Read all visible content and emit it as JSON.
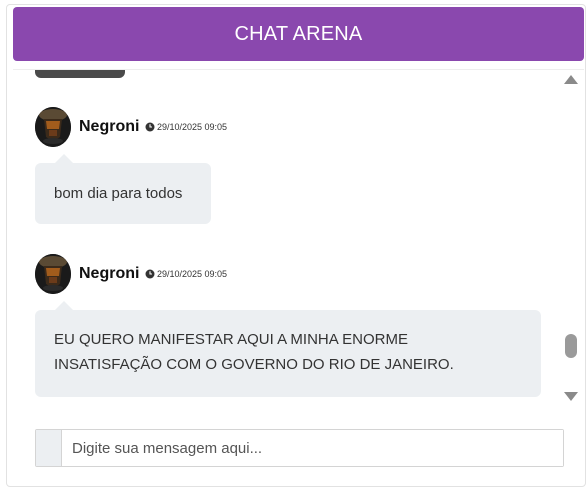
{
  "header": {
    "title": "CHAT ARENA"
  },
  "messages": [
    {
      "author": "Negroni",
      "timestamp": "29/10/2025 09:05",
      "text": "bom dia para todos"
    },
    {
      "author": "Negroni",
      "timestamp": "29/10/2025 09:05",
      "text_lines": [
        "EU QUERO MANIFESTAR AQUI A MINHA ENORME",
        "INSATISFAÇÃO COM O GOVERNO DO RIO DE JANEIRO."
      ]
    }
  ],
  "composer": {
    "placeholder": "Digite sua mensagem aqui..."
  },
  "colors": {
    "header": "#8a48ae",
    "bubble": "#eceff2"
  },
  "icons": {
    "timestamp": "clock-icon",
    "scroll_up": "triangle-up-icon",
    "scroll_down": "triangle-down-icon"
  }
}
